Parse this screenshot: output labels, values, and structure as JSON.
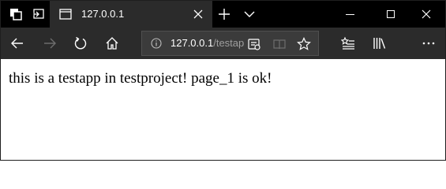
{
  "titlebar": {
    "tab_title": "127.0.0.1",
    "icons": [
      "tab-preview-icon",
      "set-aside-tabs-icon",
      "page-favicon-icon",
      "close-tab-icon",
      "new-tab-icon",
      "tab-list-chevron-icon",
      "minimize-icon",
      "maximize-icon",
      "window-close-icon"
    ]
  },
  "toolbar": {
    "url_host": "127.0.0.1",
    "url_path": "/testapp",
    "icons": [
      "back-arrow-icon",
      "forward-arrow-icon",
      "refresh-icon",
      "home-icon",
      "info-icon",
      "reader-icon",
      "book-icon",
      "star-icon",
      "favorites-list-icon",
      "library-icon",
      "more-icon"
    ]
  },
  "content": {
    "text": "this is a testapp in testproject! page_1 is ok!"
  },
  "colors": {
    "titlebar_bg": "#000000",
    "toolbar_bg": "#2b2b2b",
    "address_bg": "#3b3b3b",
    "page_bg": "#ffffff"
  }
}
